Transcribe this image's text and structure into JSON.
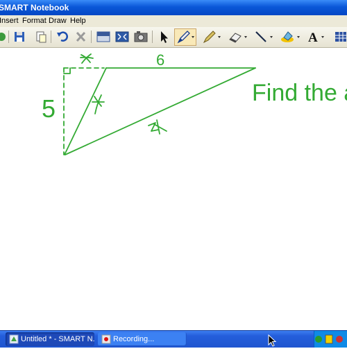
{
  "window": {
    "title": "SMART Notebook"
  },
  "menu": [
    "Insert",
    "Format",
    "Draw",
    "Help"
  ],
  "toolbar": {
    "icons": [
      "add-page-icon",
      "save-icon",
      "paste-icon",
      "undo-icon",
      "delete-icon",
      "screen-shade-icon",
      "full-screen-icon",
      "capture-icon",
      "select-icon",
      "pen-icon",
      "creative-pen-icon",
      "eraser-icon",
      "line-icon",
      "fill-icon",
      "text-icon",
      "table-icon"
    ]
  },
  "canvas": {
    "ink_color": "#33aa33",
    "labels": {
      "side_left": "5",
      "side_top": "6",
      "instruction": "Find the a"
    }
  },
  "taskbar": {
    "items": [
      {
        "label": "Untitled * - SMART N..."
      },
      {
        "label": "Recording..."
      }
    ]
  }
}
